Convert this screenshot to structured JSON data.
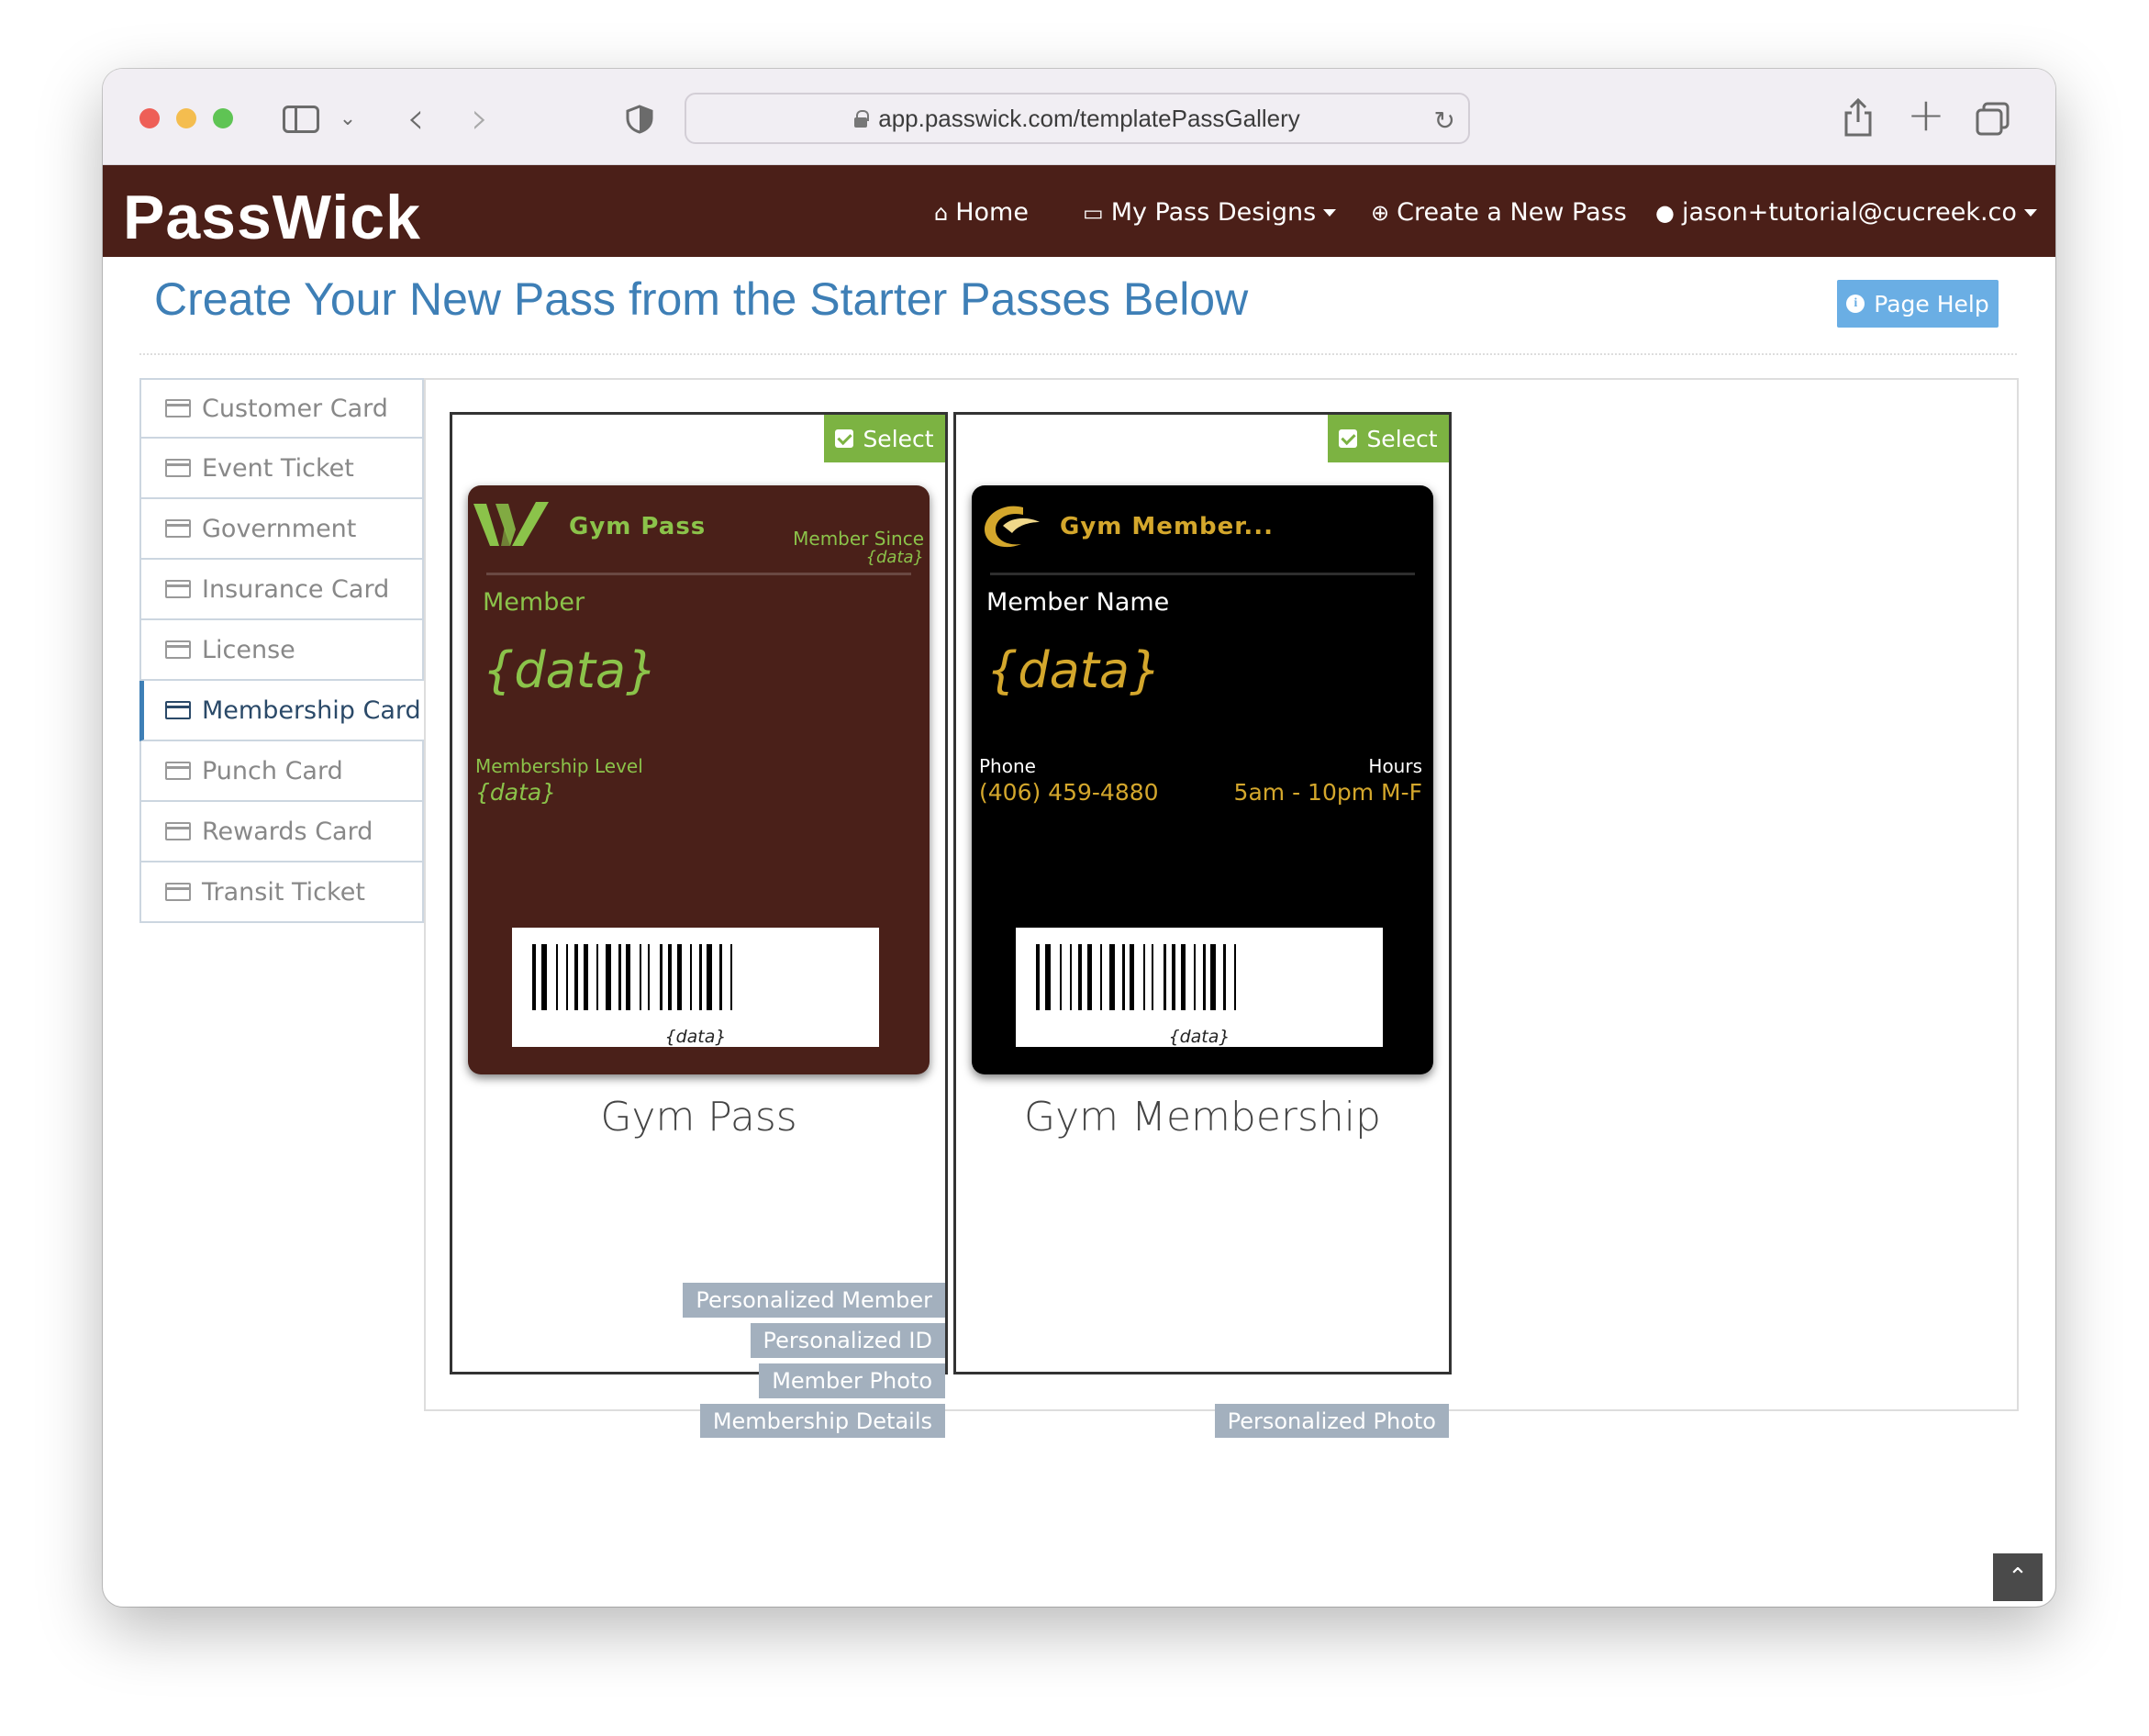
{
  "browser": {
    "url": "app.passwick.com/templatePassGallery"
  },
  "nav": {
    "logo": "PassWick",
    "home": "Home",
    "my_designs": "My Pass Designs",
    "create": "Create a New Pass",
    "account": "jason+tutorial@cucreek.co"
  },
  "page": {
    "title": "Create Your New Pass from the Starter Passes Below",
    "help": "Page Help"
  },
  "categories": [
    {
      "label": "Customer Card",
      "active": false
    },
    {
      "label": "Event Ticket",
      "active": false
    },
    {
      "label": "Government",
      "active": false
    },
    {
      "label": "Insurance Card",
      "active": false
    },
    {
      "label": "License",
      "active": false
    },
    {
      "label": "Membership Card",
      "active": true
    },
    {
      "label": "Punch Card",
      "active": false
    },
    {
      "label": "Rewards Card",
      "active": false
    },
    {
      "label": "Transit Ticket",
      "active": false
    }
  ],
  "templates": [
    {
      "select": "Select",
      "name": "Gym Pass",
      "colors": {
        "background": "#4a2019",
        "label": "#8bc34a",
        "value": "#8bc34a"
      },
      "pass": {
        "header": "Gym Pass",
        "member_since_label": "Member Since",
        "member_since_value": "{data}",
        "primary_label": "Member",
        "primary_value": "{data}",
        "secondary_label": "Membership Level",
        "secondary_value": "{data}",
        "barcode_text": "{data}"
      },
      "tags": [
        "Personalized Member",
        "Personalized ID",
        "Member Photo",
        "Membership Details"
      ]
    },
    {
      "select": "Select",
      "name": "Gym Membership",
      "colors": {
        "background": "#000000",
        "label": "#ffffff",
        "value": "#d4a72c"
      },
      "pass": {
        "header": "Gym Member...",
        "primary_label": "Member Name",
        "primary_value": "{data}",
        "phone_label": "Phone",
        "phone_value": "(406) 459-4880",
        "hours_label": "Hours",
        "hours_value": "5am - 10pm M-F",
        "barcode_text": "{data}"
      },
      "tags": [
        "Personalized Photo"
      ]
    }
  ],
  "colors": {
    "nav_bg": "#4b1f18",
    "title": "#3e7fb6",
    "select_green": "#7cb342",
    "help_btn": "#6aaee4",
    "tag_bg": "#a3b0be"
  }
}
